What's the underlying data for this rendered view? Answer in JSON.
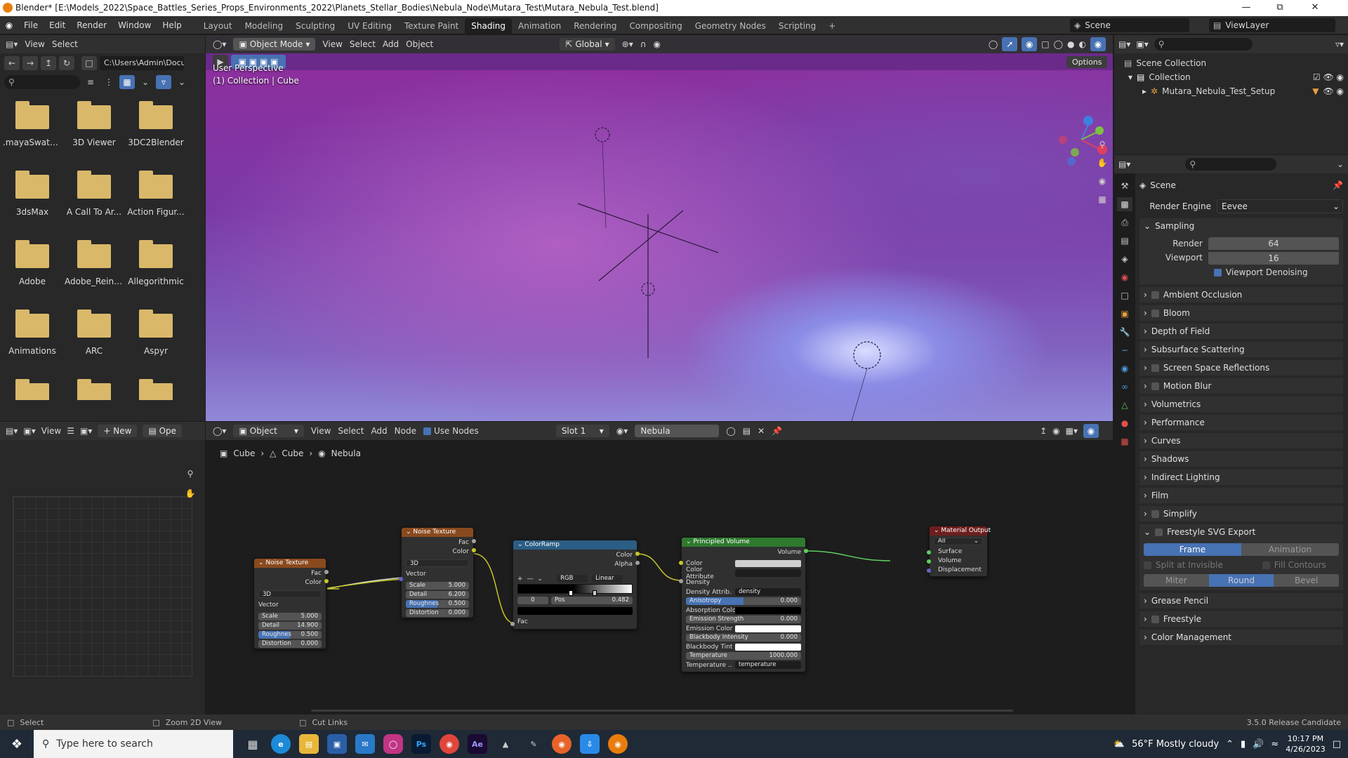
{
  "window": {
    "title": "Blender* [E:\\Models_2022\\Space_Battles_Series_Props_Environments_2022\\Planets_Stellar_Bodies\\Nebula_Node\\Mutara_Test\\Mutara_Nebula_Test.blend]"
  },
  "menus": [
    "File",
    "Edit",
    "Render",
    "Window",
    "Help"
  ],
  "workspaces": [
    "Layout",
    "Modeling",
    "Sculpting",
    "UV Editing",
    "Texture Paint",
    "Shading",
    "Animation",
    "Rendering",
    "Compositing",
    "Geometry Nodes",
    "Scripting"
  ],
  "active_workspace": "Shading",
  "scene": {
    "label": "Scene",
    "viewlayer": "ViewLayer"
  },
  "filebrowser": {
    "view": "View",
    "select": "Select",
    "path": "C:\\Users\\Admin\\Docu...",
    "items": [
      ".mayaSwatc...",
      "3D Viewer",
      "3DC2Blender",
      "3dsMax",
      "A Call To Ar...",
      "Action Figur...",
      "Adobe",
      "Adobe_Reins...",
      "Allegorithmic",
      "Animations",
      "ARC",
      "Aspyr",
      "",
      "",
      ""
    ]
  },
  "viewport": {
    "mode": "Object Mode",
    "menu": [
      "View",
      "Select",
      "Add",
      "Object"
    ],
    "orientation": "Global",
    "options": "Options",
    "info_line1": "User Perspective",
    "info_line2": "(1) Collection | Cube"
  },
  "outliner": {
    "root": "Scene Collection",
    "collection": "Collection",
    "object": "Mutara_Nebula_Test_Setup"
  },
  "properties": {
    "scene_label": "Scene",
    "render_engine_label": "Render Engine",
    "render_engine": "Eevee",
    "sampling": "Sampling",
    "render_label": "Render",
    "render_value": "64",
    "viewport_label": "Viewport",
    "viewport_value": "16",
    "viewport_denoising": "Viewport Denoising",
    "panels": [
      {
        "label": "Ambient Occlusion",
        "check": true
      },
      {
        "label": "Bloom",
        "check": true
      },
      {
        "label": "Depth of Field",
        "check": false
      },
      {
        "label": "Subsurface Scattering",
        "check": false
      },
      {
        "label": "Screen Space Reflections",
        "check": true
      },
      {
        "label": "Motion Blur",
        "check": true
      },
      {
        "label": "Volumetrics",
        "check": false
      },
      {
        "label": "Performance",
        "check": false
      },
      {
        "label": "Curves",
        "check": false
      },
      {
        "label": "Shadows",
        "check": false
      },
      {
        "label": "Indirect Lighting",
        "check": false
      },
      {
        "label": "Film",
        "check": false
      },
      {
        "label": "Simplify",
        "check": true
      }
    ],
    "freestyle_svg": "Freestyle SVG Export",
    "frame": "Frame",
    "animation": "Animation",
    "split_invisible": "Split at Invisible",
    "fill_contours": "Fill Contours",
    "miter": "Miter",
    "round": "Round",
    "bevel": "Bevel",
    "grease_pencil": "Grease Pencil",
    "freestyle": "Freestyle",
    "color_management": "Color Management"
  },
  "image_editor": {
    "view": "View",
    "new": "New",
    "open": "Ope"
  },
  "node_editor": {
    "mode": "Object",
    "menu": [
      "View",
      "Select",
      "Add",
      "Node"
    ],
    "use_nodes": "Use Nodes",
    "slot": "Slot 1",
    "material": "Nebula",
    "breadcrumb": [
      "Cube",
      "Cube",
      "Nebula"
    ],
    "noise1": {
      "title": "Noise Texture",
      "fac": "Fac",
      "color": "Color",
      "dim": "3D",
      "vector": "Vector",
      "scale_l": "Scale",
      "scale": "5.000",
      "detail_l": "Detail",
      "detail": "14.900",
      "rough_l": "Roughnes",
      "rough": "0.500",
      "dist_l": "Distortion",
      "dist": "0.000"
    },
    "noise2": {
      "title": "Noise Texture",
      "fac": "Fac",
      "color": "Color",
      "dim": "3D",
      "vector": "Vector",
      "scale_l": "Scale",
      "scale": "5.000",
      "detail_l": "Detail",
      "detail": "6.200",
      "rough_l": "Roughnes",
      "rough": "0.500",
      "dist_l": "Distortion",
      "dist": "0.000"
    },
    "ramp": {
      "title": "ColorRamp",
      "color": "Color",
      "alpha": "Alpha",
      "mode": "RGB",
      "interp": "Linear",
      "index": "0",
      "pos_l": "Pos",
      "pos": "0.482",
      "fac": "Fac"
    },
    "volume": {
      "title": "Principled Volume",
      "out": "Volume",
      "color": "Color",
      "color_attr": "Color Attribute",
      "density": "Density",
      "density_attr_l": "Density Attrib...",
      "density_attr": "density",
      "aniso_l": "Anisotropy",
      "aniso": "0.000",
      "absorb": "Absorption Color",
      "emis_str_l": "Emission Strength",
      "emis_str": "0.000",
      "emis_col": "Emission Color",
      "bb_int_l": "Blackbody Intensity",
      "bb_int": "0.000",
      "bb_tint": "Blackbody Tint",
      "temp_l": "Temperature",
      "temp": "1000.000",
      "temp_attr_l": "Temperature ...",
      "temp_attr": "temperature"
    },
    "output": {
      "title": "Material Output",
      "target": "All",
      "surface": "Surface",
      "volume": "Volume",
      "disp": "Displacement"
    }
  },
  "statusbar": {
    "select": "Select",
    "zoom": "Zoom 2D View",
    "cut": "Cut Links",
    "version": "3.5.0 Release Candidate"
  },
  "taskbar": {
    "search": "Type here to search",
    "weather": "56°F  Mostly cloudy",
    "time": "10:17 PM",
    "date": "4/26/2023"
  }
}
